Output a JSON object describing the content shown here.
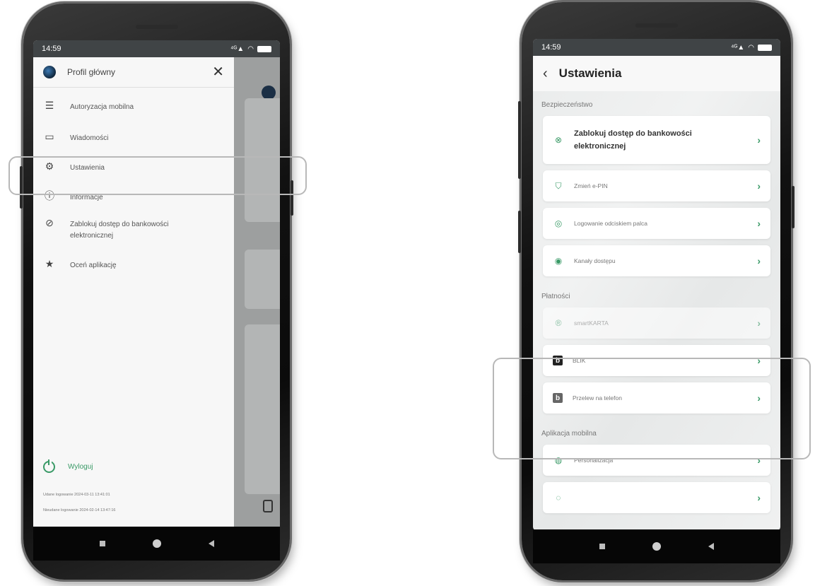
{
  "left_phone": {
    "status": {
      "time": "14:59"
    },
    "drawer": {
      "title": "Profil główny",
      "items": [
        {
          "label": "Autoryzacja mobilna",
          "icon": "mobile-auth-icon"
        },
        {
          "label": "Wiadomości",
          "icon": "message-icon"
        },
        {
          "label": "Ustawienia",
          "icon": "gear-icon"
        },
        {
          "label": "Informacje",
          "icon": "info-icon"
        },
        {
          "label": "Zablokuj dostęp do bankowości elektronicznej",
          "icon": "block-icon"
        },
        {
          "label": "Oceń aplikację",
          "icon": "star-icon"
        }
      ],
      "logout": "Wyloguj",
      "last_login_ok": "Udane logowanie 2024-03-11 13:41:01",
      "last_login_fail": "Nieudane logowanie 2024-02-14 13:47:16"
    }
  },
  "right_phone": {
    "status": {
      "time": "14:59"
    },
    "header": {
      "title": "Ustawienia"
    },
    "sections": [
      {
        "label": "Bezpieczeństwo",
        "items": [
          {
            "label": "Zablokuj dostęp do bankowości elektronicznej",
            "icon": "block-circle-icon"
          },
          {
            "label": "Zmień e-PIN",
            "icon": "shield-icon"
          },
          {
            "label": "Logowanie odciskiem palca",
            "icon": "fingerprint-icon"
          },
          {
            "label": "Kanały dostępu",
            "icon": "access-channels-icon"
          }
        ]
      },
      {
        "label": "Płatności",
        "items": [
          {
            "label": "smartKARTA",
            "icon": "smartcard-icon"
          },
          {
            "label": "BLIK",
            "icon": "blik-icon"
          },
          {
            "label": "Przelew na telefon",
            "icon": "blik-phone-icon"
          }
        ]
      },
      {
        "label": "Aplikacja mobilna",
        "items": [
          {
            "label": "Personalizacja",
            "icon": "personalize-icon"
          }
        ]
      }
    ]
  },
  "colors": {
    "accent": "#3a9a67",
    "highlight": "#b8b8b8"
  }
}
